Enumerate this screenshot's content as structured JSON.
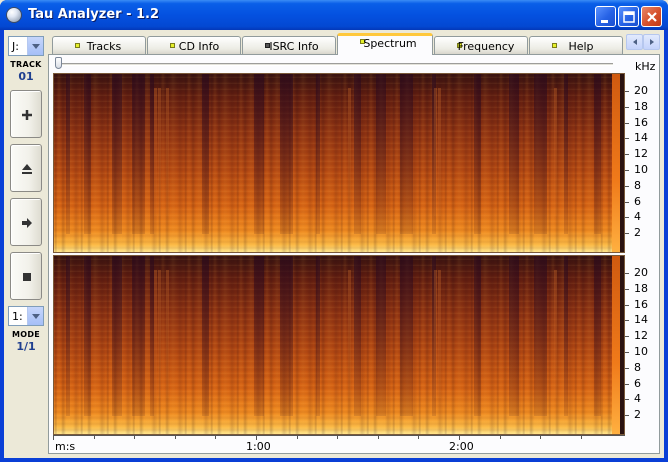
{
  "window": {
    "title": "Tau Analyzer - 1.2",
    "buttons": [
      "minimize",
      "maximize",
      "close"
    ]
  },
  "left_panel": {
    "drive_select": {
      "value": "J:"
    },
    "track_label": "TRACK",
    "track_number": "01",
    "buttons": [
      {
        "name": "add",
        "icon": "plus-icon"
      },
      {
        "name": "eject",
        "icon": "eject-icon"
      },
      {
        "name": "play",
        "icon": "arrow-right-icon"
      },
      {
        "name": "stop",
        "icon": "stop-icon"
      }
    ],
    "mode_select": {
      "value": "1:"
    },
    "mode_label": "MODE",
    "mode_value": "1/1"
  },
  "tabs": [
    {
      "label": "Tracks",
      "active": false,
      "led": "yellow"
    },
    {
      "label": "CD Info",
      "active": false,
      "led": "yellow"
    },
    {
      "label": "ISRC Info",
      "active": false,
      "led": "dark"
    },
    {
      "label": "Spectrum",
      "active": true,
      "led": "yellow"
    },
    {
      "label": "Frequency",
      "active": false,
      "led": "yellow"
    },
    {
      "label": "Help",
      "active": false,
      "led": "yellow"
    }
  ],
  "spectrum": {
    "y_unit": "kHz",
    "y_ticks": [
      "20",
      "18",
      "16",
      "14",
      "12",
      "10",
      "8",
      "6",
      "4",
      "2"
    ],
    "x_unit": "m:s",
    "x_labels": [
      "1:00",
      "2:00"
    ],
    "position_slider": 0,
    "colors": {
      "low": "#3a1410",
      "mid": "#b84b12",
      "high": "#ffec96"
    }
  }
}
